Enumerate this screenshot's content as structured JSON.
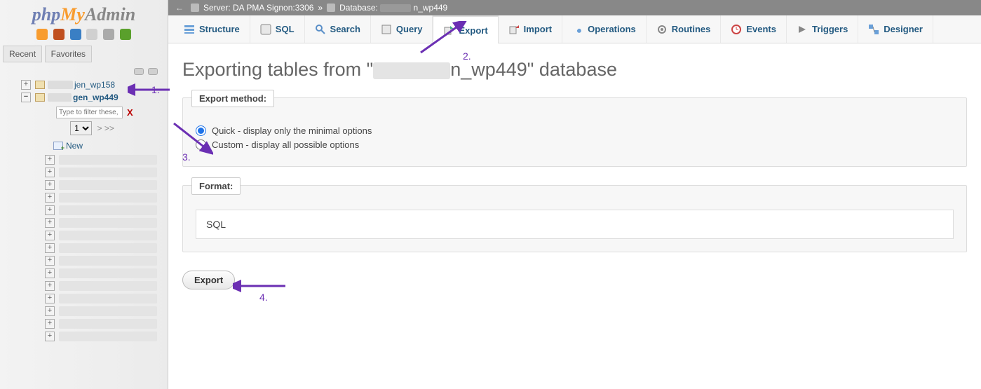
{
  "logo": {
    "part1": "php",
    "part2": "My",
    "part3": "Admin"
  },
  "sidebar": {
    "recent_label": "Recent",
    "favorites_label": "Favorites",
    "databases": [
      {
        "suffix": "jen_wp158",
        "expanded": false
      },
      {
        "suffix": "gen_wp449",
        "expanded": true
      }
    ],
    "filter_placeholder": "Type to filter these, Enter to search all",
    "filter_clear": "X",
    "page_select_value": "1",
    "page_nav": "> >>",
    "new_label": "New"
  },
  "serverbar": {
    "server_label_prefix": "Server: ",
    "server_name": "DA PMA Signon:3306",
    "sep": "»",
    "database_label_prefix": "Database: ",
    "database_suffix": "n_wp449"
  },
  "tabs": [
    {
      "key": "structure",
      "label": "Structure"
    },
    {
      "key": "sql",
      "label": "SQL"
    },
    {
      "key": "search",
      "label": "Search"
    },
    {
      "key": "query",
      "label": "Query"
    },
    {
      "key": "export",
      "label": "Export"
    },
    {
      "key": "import",
      "label": "Import"
    },
    {
      "key": "operations",
      "label": "Operations"
    },
    {
      "key": "routines",
      "label": "Routines"
    },
    {
      "key": "events",
      "label": "Events"
    },
    {
      "key": "triggers",
      "label": "Triggers"
    },
    {
      "key": "designer",
      "label": "Designer"
    }
  ],
  "page": {
    "heading_prefix": "Exporting tables from \"",
    "heading_suffix": "n_wp449\" database"
  },
  "export_method": {
    "legend": "Export method:",
    "quick_label": "Quick - display only the minimal options",
    "custom_label": "Custom - display all possible options",
    "selected": "quick"
  },
  "format": {
    "legend": "Format:",
    "value": "SQL"
  },
  "export_button_label": "Export",
  "annotations": {
    "l1": "1.",
    "l2": "2.",
    "l3": "3.",
    "l4": "4."
  }
}
